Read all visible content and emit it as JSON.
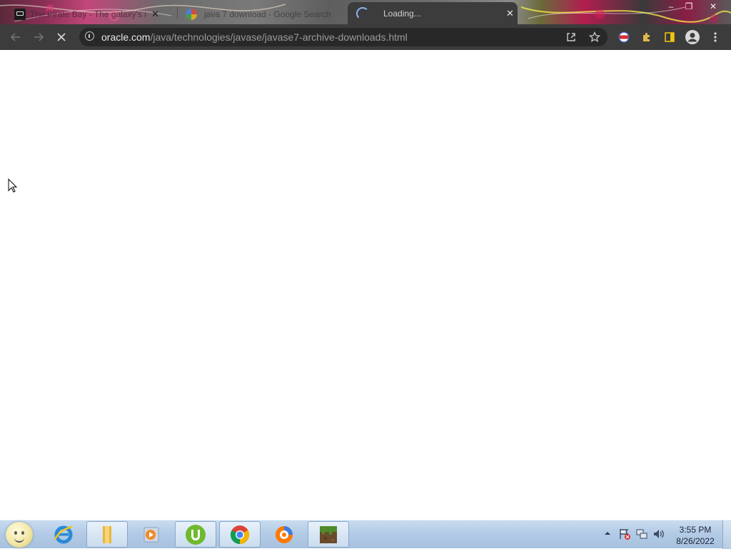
{
  "browser": {
    "tabs": [
      {
        "title": "The Pirate Bay - The galaxy's most resilient BitTorrent site",
        "favicon": "pirate-bay-icon",
        "active": false
      },
      {
        "title": "java 7 download - Google Search",
        "favicon": "google-icon",
        "active": false
      },
      {
        "title": "Loading...",
        "favicon": "loading-spinner-icon",
        "active": true
      }
    ],
    "window_controls": {
      "minimize": "–",
      "maximize": "❐",
      "close": "✕"
    },
    "toolbar": {
      "url_host": "oracle.com",
      "url_path": "/java/technologies/javase/javase7-archive-downloads.html"
    }
  },
  "taskbar": {
    "apps": [
      {
        "name": "internet-explorer",
        "icon": "ie-icon"
      },
      {
        "name": "file-explorer",
        "icon": "folder-icon"
      },
      {
        "name": "media-player",
        "icon": "media-player-icon"
      },
      {
        "name": "utorrent",
        "icon": "utorrent-icon"
      },
      {
        "name": "chrome",
        "icon": "chrome-icon"
      },
      {
        "name": "avast-browser",
        "icon": "avast-icon"
      },
      {
        "name": "minecraft",
        "icon": "minecraft-icon"
      }
    ],
    "clock": {
      "time": "3:55 PM",
      "date": "8/26/2022"
    }
  },
  "colors": {
    "toolbar": "#3c3c3c",
    "omnibox": "#282828",
    "page": "#ffffff",
    "taskbar": "#b3cbe6"
  }
}
